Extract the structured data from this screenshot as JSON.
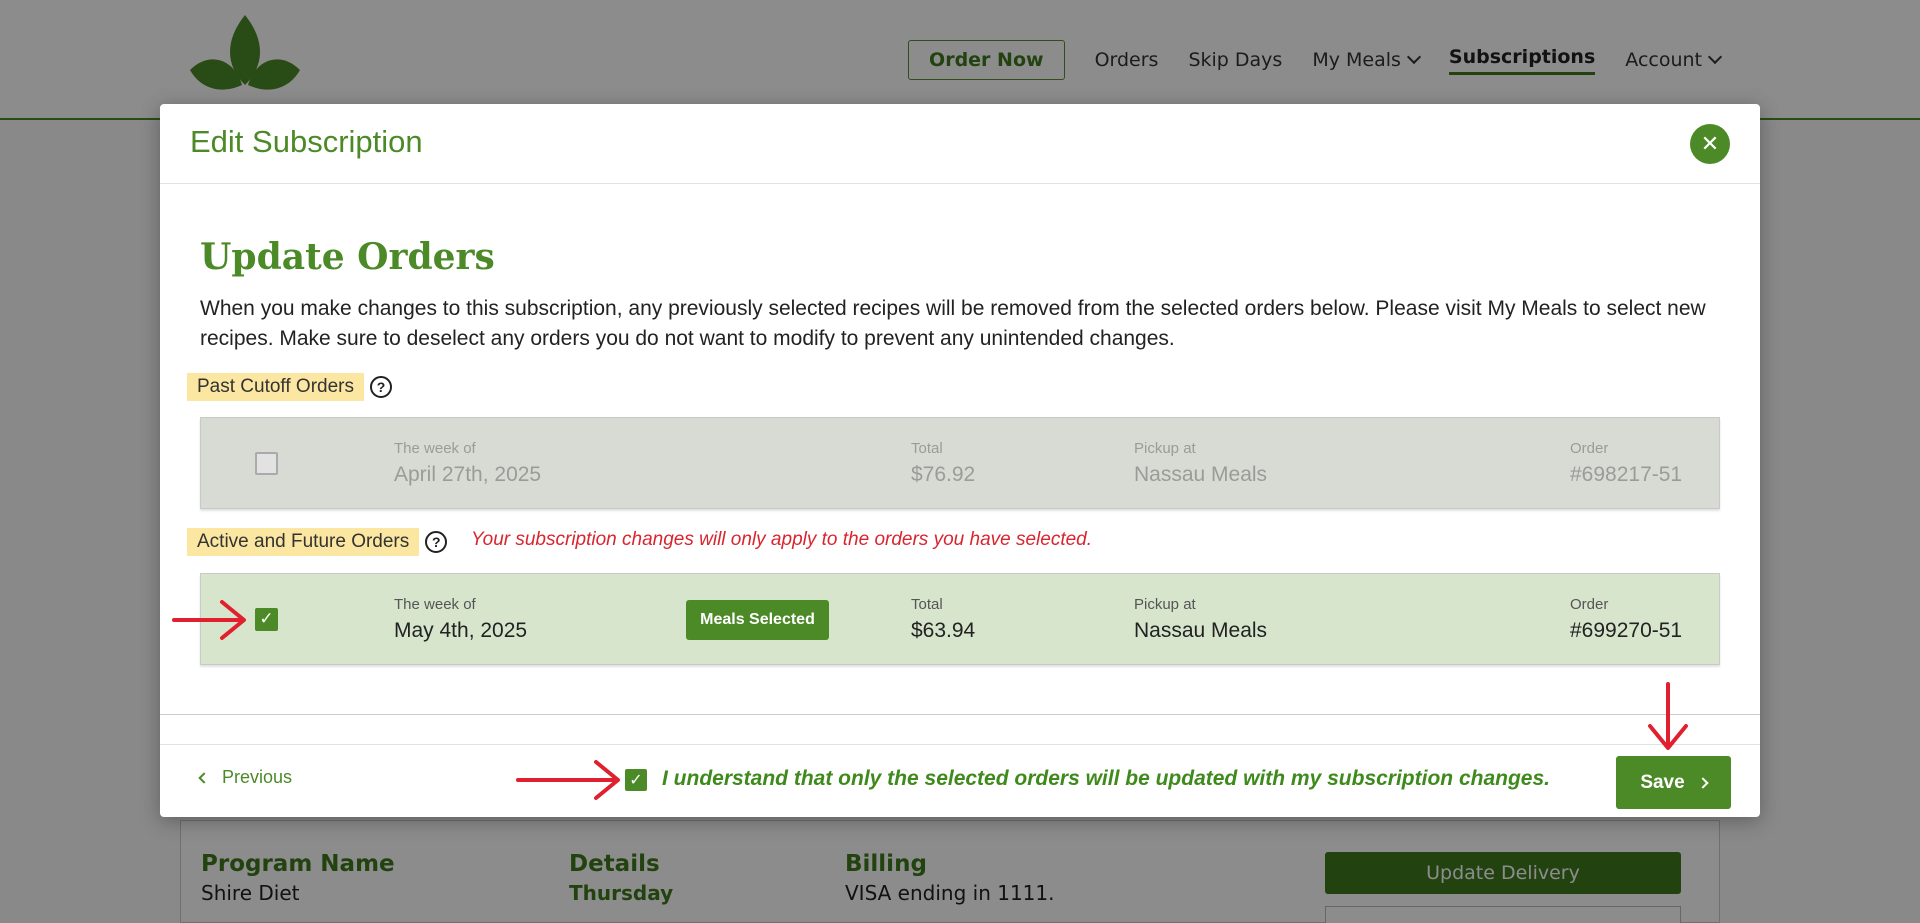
{
  "nav": {
    "order_now": "Order Now",
    "orders": "Orders",
    "skip_days": "Skip Days",
    "my_meals": "My Meals",
    "subscriptions": "Subscriptions",
    "account": "Account"
  },
  "background_card": {
    "program_name_label": "Program Name",
    "program_name_value": "Shire Diet",
    "details_label": "Details",
    "details_value": "Thursday",
    "billing_label": "Billing",
    "billing_value": "VISA ending in 1111.",
    "update_delivery": "Update Delivery"
  },
  "modal": {
    "title": "Edit Subscription",
    "close_symbol": "✕",
    "section_title": "Update Orders",
    "intro": "When you make changes to this subscription, any previously selected recipes will be removed from the selected orders below. Please visit My Meals to select new recipes. Make sure to deselect any orders you do not want to modify to prevent any unintended changes.",
    "past_label": "Past Cutoff Orders",
    "active_label": "Active and Future Orders",
    "help_symbol": "?",
    "notice": "Your subscription changes will only apply to the orders you have selected.",
    "past_order": {
      "checked": false,
      "week_label": "The week of",
      "week_value": "April 27th, 2025",
      "total_label": "Total",
      "total_value": "$76.92",
      "pickup_label": "Pickup at",
      "pickup_value": "Nassau Meals",
      "order_label": "Order",
      "order_value": "#698217-51"
    },
    "active_order": {
      "checked": true,
      "week_label": "The week of",
      "week_value": "May 4th, 2025",
      "badge": "Meals Selected",
      "total_label": "Total",
      "total_value": "$63.94",
      "pickup_label": "Pickup at",
      "pickup_value": "Nassau Meals",
      "order_label": "Order",
      "order_value": "#699270-51"
    },
    "footer": {
      "previous": "Previous",
      "acknowledge": "I understand that only the selected orders will be updated with my subscription changes.",
      "acknowledge_checked": true,
      "save": "Save"
    }
  },
  "colors": {
    "brand_green": "#4c8a28",
    "highlight": "#fbe7a1",
    "warning_red": "#d9252f",
    "annotation_red": "#e0202e"
  },
  "icons": [
    "logo-icon",
    "chevron-down-icon",
    "close-icon",
    "help-icon",
    "checkmark-icon",
    "chevron-left-icon",
    "chevron-right-icon",
    "arrow-icon"
  ]
}
